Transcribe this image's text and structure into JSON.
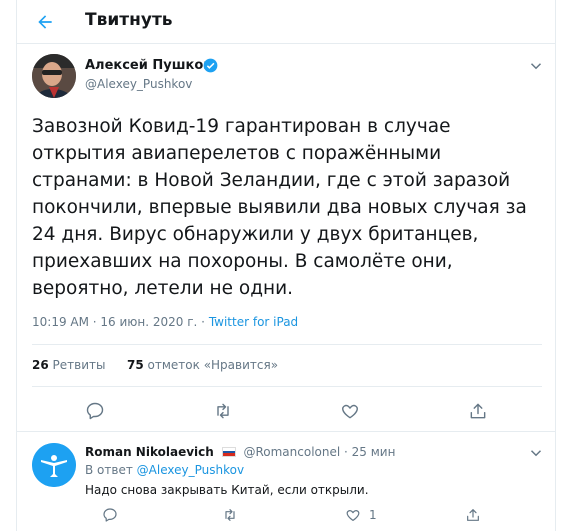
{
  "header": {
    "title": "Твитнуть",
    "back_icon": "arrow-left-icon"
  },
  "tweet": {
    "author_name": "Алексей Пушков",
    "author_handle": "@Alexey_Pushkov",
    "verified_icon": "verified-badge-icon",
    "text": "Завозной Ковид-19 гарантирован в случае открытия авиаперелетов с поражёнными странами: в Новой Зеландии, где с этой заразой покончили, впервые выявили два новых случая за 24 дня. Вирус обнаружили у двух британцев, приехавших на похороны. В самолёте они, вероятно, летели не одни.",
    "time": "10:19 AM",
    "date": "16 июн. 2020 г.",
    "separator": " · ",
    "source": "Twitter for iPad",
    "retweets_count": "26",
    "retweets_label": "Ретвиты",
    "likes_count": "75",
    "likes_label": "отметок «Нравится»"
  },
  "reply": {
    "author_name": "Roman Nikolaevich",
    "flag": "russia-flag",
    "author_handle": "@Romancolonel",
    "dot": " · ",
    "time": "25 мин",
    "reply_to_prefix": "В ответ",
    "reply_to_handle": "@Alexey_Pushkov",
    "text": "Надо снова закрывать Китай, если открыли.",
    "like_count": "1"
  },
  "colors": {
    "link": "#1b95e0",
    "muted": "#657786",
    "border": "#e6ecf0",
    "avatar2": "#1da1f2"
  }
}
